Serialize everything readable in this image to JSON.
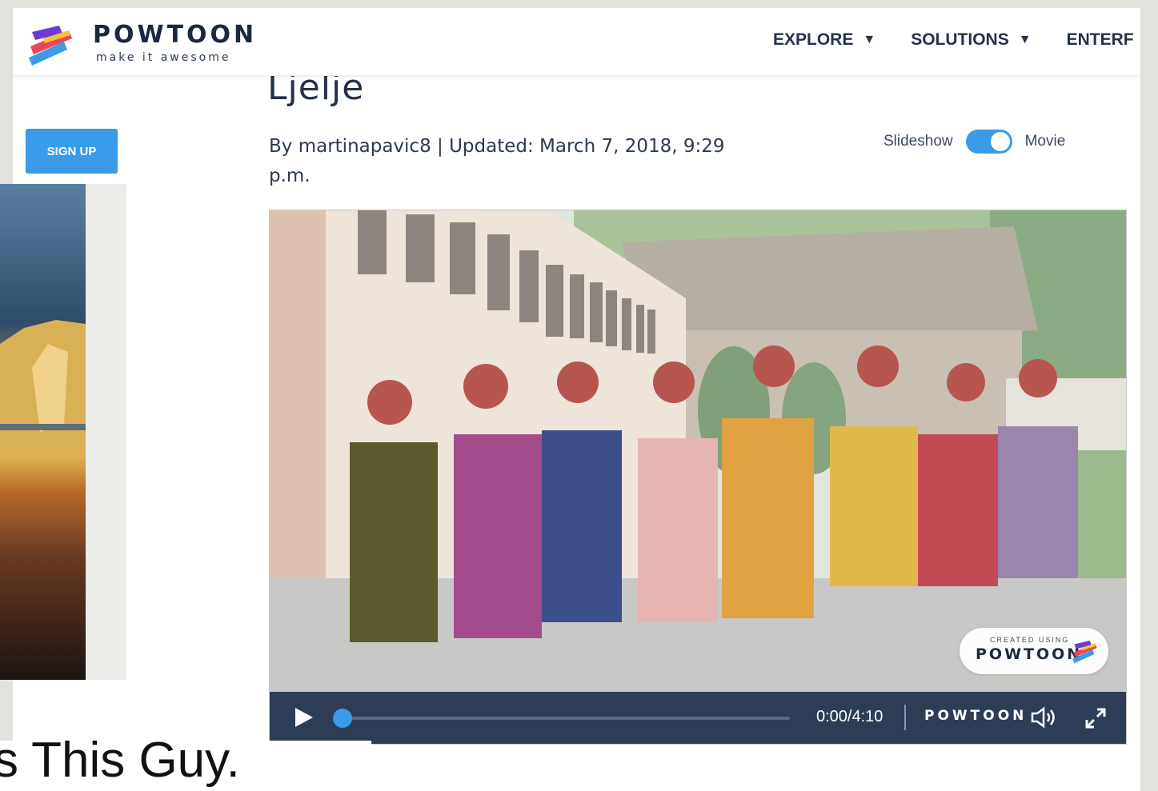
{
  "brand": {
    "name": "POWTOON",
    "tagline": "make it awesome",
    "colors": {
      "accent": "#3a9be8",
      "navy": "#1b2940",
      "yellow": "#f6c42c",
      "red": "#e94560",
      "purple": "#6a3bd1"
    }
  },
  "nav": {
    "items": [
      {
        "label": "EXPLORE"
      },
      {
        "label": "SOLUTIONS"
      },
      {
        "label": "ENTERF"
      }
    ],
    "caret": "▼"
  },
  "sidebar": {
    "signup_label": "SIGN UP"
  },
  "page": {
    "title": "Ljelje",
    "byline": "By martinapavic8 | Updated: March 7, 2018, 9:29 p.m."
  },
  "view_toggle": {
    "left_label": "Slideshow",
    "right_label": "Movie",
    "state": "on"
  },
  "player": {
    "time": "0:00/4:10",
    "brand": "POWTOON",
    "badge_small": "CREATED USING",
    "badge_word": "POWTOON",
    "progress": 0
  },
  "background_text": "s This Guy."
}
